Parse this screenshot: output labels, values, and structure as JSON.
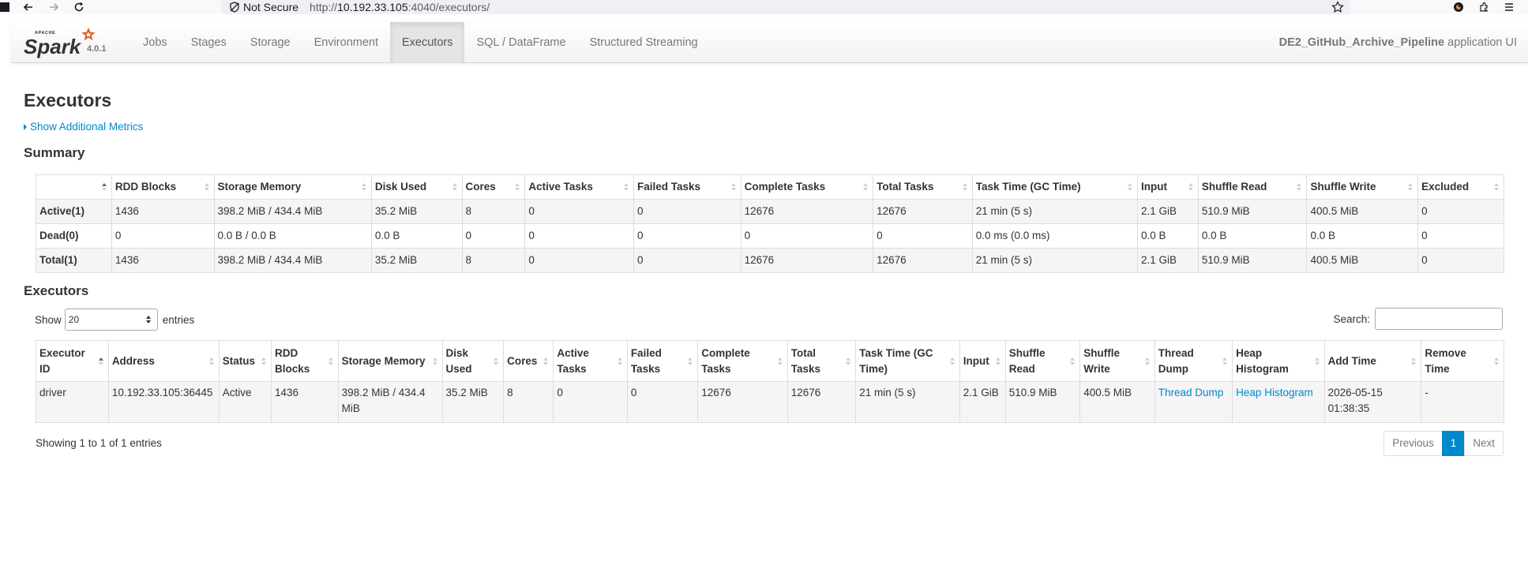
{
  "browser": {
    "security_label": "Not Secure",
    "url_prefix": "http://",
    "url_host": "10.192.33.105",
    "url_rest": ":4040/executors/"
  },
  "navbar": {
    "brand_small": "APACHE",
    "brand": "Spark",
    "version": "4.0.1",
    "items": [
      {
        "label": "Jobs"
      },
      {
        "label": "Stages"
      },
      {
        "label": "Storage"
      },
      {
        "label": "Environment"
      },
      {
        "label": "Executors",
        "active": true
      },
      {
        "label": "SQL / DataFrame"
      },
      {
        "label": "Structured Streaming"
      }
    ],
    "app_name": "DE2_GitHub_Archive_Pipeline",
    "app_suffix": " application UI"
  },
  "page": {
    "title": "Executors",
    "show_metrics": "Show Additional Metrics",
    "summary_title": "Summary",
    "executors_title": "Executors"
  },
  "summary": {
    "headers": [
      "",
      "RDD Blocks",
      "Storage Memory",
      "Disk Used",
      "Cores",
      "Active Tasks",
      "Failed Tasks",
      "Complete Tasks",
      "Total Tasks",
      "Task Time (GC Time)",
      "Input",
      "Shuffle Read",
      "Shuffle Write",
      "Excluded"
    ],
    "rows": [
      [
        "Active(1)",
        "1436",
        "398.2 MiB / 434.4 MiB",
        "35.2 MiB",
        "8",
        "0",
        "0",
        "12676",
        "12676",
        "21 min (5 s)",
        "2.1 GiB",
        "510.9 MiB",
        "400.5 MiB",
        "0"
      ],
      [
        "Dead(0)",
        "0",
        "0.0 B / 0.0 B",
        "0.0 B",
        "0",
        "0",
        "0",
        "0",
        "0",
        "0.0 ms (0.0 ms)",
        "0.0 B",
        "0.0 B",
        "0.0 B",
        "0"
      ],
      [
        "Total(1)",
        "1436",
        "398.2 MiB / 434.4 MiB",
        "35.2 MiB",
        "8",
        "0",
        "0",
        "12676",
        "12676",
        "21 min (5 s)",
        "2.1 GiB",
        "510.9 MiB",
        "400.5 MiB",
        "0"
      ]
    ]
  },
  "executors": {
    "show_label": "Show",
    "page_size": "20",
    "entries_label": "entries",
    "search_label": "Search:",
    "headers": [
      "Executor ID",
      "Address",
      "Status",
      "RDD Blocks",
      "Storage Memory",
      "Disk Used",
      "Cores",
      "Active Tasks",
      "Failed Tasks",
      "Complete Tasks",
      "Total Tasks",
      "Task Time (GC Time)",
      "Input",
      "Shuffle Read",
      "Shuffle Write",
      "Thread Dump",
      "Heap Histogram",
      "Add Time",
      "Remove Time"
    ],
    "row": {
      "id": "driver",
      "address": "10.192.33.105:36445",
      "status": "Active",
      "rdd_blocks": "1436",
      "storage_memory": "398.2 MiB / 434.4 MiB",
      "disk_used": "35.2 MiB",
      "cores": "8",
      "active_tasks": "0",
      "failed_tasks": "0",
      "complete_tasks": "12676",
      "total_tasks": "12676",
      "task_time": "21 min (5 s)",
      "input": "2.1 GiB",
      "shuffle_read": "510.9 MiB",
      "shuffle_write": "400.5 MiB",
      "thread_dump": "Thread Dump",
      "heap_histogram": "Heap Histogram",
      "add_time": "2026-05-15 01:38:35",
      "remove_time": "-"
    },
    "info": "Showing 1 to 1 of 1 entries",
    "pager": {
      "previous": "Previous",
      "current": "1",
      "next": "Next"
    }
  },
  "colors": {
    "link": "#0088cc",
    "spark_orange": "#e25a1c"
  }
}
